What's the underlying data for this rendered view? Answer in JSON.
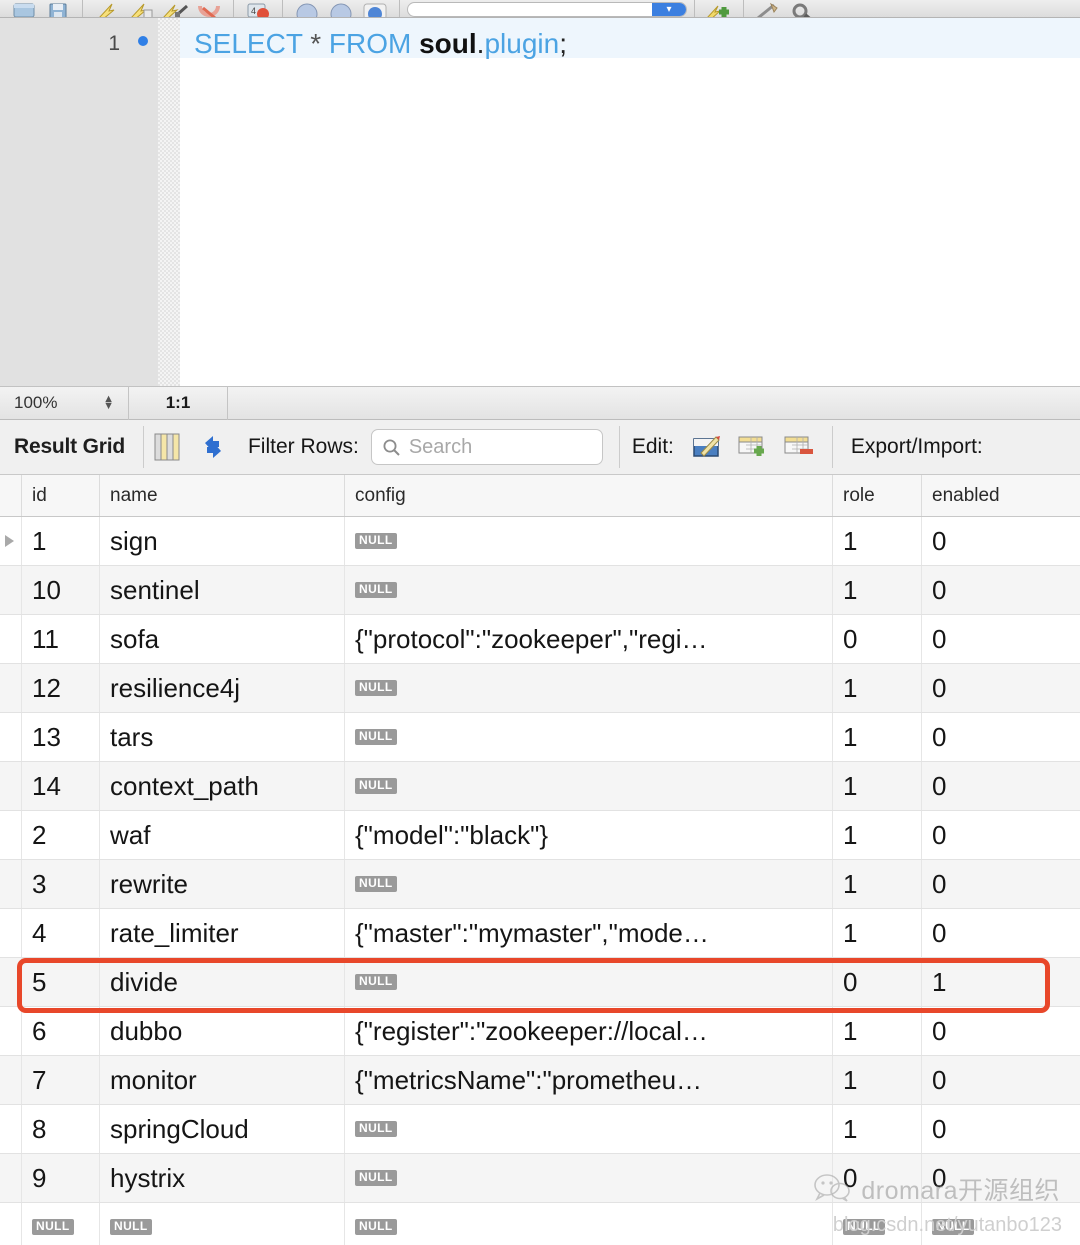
{
  "toolbar": {
    "buttons": [
      {
        "name": "new-tab-icon",
        "label": ""
      },
      {
        "name": "save-icon",
        "label": ""
      },
      {
        "name": "execute-icon",
        "label": ""
      },
      {
        "name": "execute-current-icon",
        "label": ""
      },
      {
        "name": "explain-icon",
        "label": ""
      },
      {
        "name": "stop-icon",
        "label": ""
      },
      {
        "name": "toggle-stop-on-error-icon",
        "label": ""
      },
      {
        "name": "commit-icon",
        "label": ""
      },
      {
        "name": "rollback-icon",
        "label": ""
      },
      {
        "name": "autocommit-icon",
        "label": ""
      },
      {
        "name": "add-snippet-icon",
        "label": ""
      },
      {
        "name": "beautify-icon",
        "label": ""
      },
      {
        "name": "find-icon",
        "label": ""
      }
    ],
    "search_placeholder": "",
    "search_value": "",
    "search_go_label": "▾"
  },
  "editor": {
    "line_number": "1",
    "sql": {
      "select_kw": "SELECT",
      "star": "*",
      "from_kw": "FROM",
      "schema": "soul",
      "dot": ".",
      "table": "plugin",
      "semicolon": ";"
    }
  },
  "statusbar": {
    "zoom": "100%",
    "cursor_position": "1:1"
  },
  "result_toolbar": {
    "title": "Result Grid",
    "grid_view_icon": "grid-view-icon",
    "refresh_icon": "refresh-icon",
    "filter_label": "Filter Rows:",
    "search_placeholder": "Search",
    "search_value": "",
    "edit_label": "Edit:",
    "edit_icons": [
      "edit-row-icon",
      "insert-row-icon",
      "delete-row-icon"
    ],
    "export_label": "Export/Import:"
  },
  "grid": {
    "columns": [
      "id",
      "name",
      "config",
      "role",
      "enabled"
    ],
    "rows": [
      {
        "marker": true,
        "id": "1",
        "name": "sign",
        "config": "NULL",
        "config_null": true,
        "role": "1",
        "enabled": "0"
      },
      {
        "marker": false,
        "id": "10",
        "name": "sentinel",
        "config": "NULL",
        "config_null": true,
        "role": "1",
        "enabled": "0"
      },
      {
        "marker": false,
        "id": "11",
        "name": "sofa",
        "config": "{\"protocol\":\"zookeeper\",\"regi…",
        "config_null": false,
        "role": "0",
        "enabled": "0"
      },
      {
        "marker": false,
        "id": "12",
        "name": "resilience4j",
        "config": "NULL",
        "config_null": true,
        "role": "1",
        "enabled": "0"
      },
      {
        "marker": false,
        "id": "13",
        "name": "tars",
        "config": "NULL",
        "config_null": true,
        "role": "1",
        "enabled": "0"
      },
      {
        "marker": false,
        "id": "14",
        "name": "context_path",
        "config": "NULL",
        "config_null": true,
        "role": "1",
        "enabled": "0"
      },
      {
        "marker": false,
        "id": "2",
        "name": "waf",
        "config": "{\"model\":\"black\"}",
        "config_null": false,
        "role": "1",
        "enabled": "0"
      },
      {
        "marker": false,
        "id": "3",
        "name": "rewrite",
        "config": "NULL",
        "config_null": true,
        "role": "1",
        "enabled": "0"
      },
      {
        "marker": false,
        "id": "4",
        "name": "rate_limiter",
        "config": "{\"master\":\"mymaster\",\"mode…",
        "config_null": false,
        "role": "1",
        "enabled": "0"
      },
      {
        "marker": false,
        "id": "5",
        "name": "divide",
        "config": "NULL",
        "config_null": true,
        "role": "0",
        "enabled": "1",
        "highlighted": true
      },
      {
        "marker": false,
        "id": "6",
        "name": "dubbo",
        "config": "{\"register\":\"zookeeper://local…",
        "config_null": false,
        "role": "1",
        "enabled": "0"
      },
      {
        "marker": false,
        "id": "7",
        "name": "monitor",
        "config": "{\"metricsName\":\"prometheu…",
        "config_null": false,
        "role": "1",
        "enabled": "0"
      },
      {
        "marker": false,
        "id": "8",
        "name": "springCloud",
        "config": "NULL",
        "config_null": true,
        "role": "1",
        "enabled": "0"
      },
      {
        "marker": false,
        "id": "9",
        "name": "hystrix",
        "config": "NULL",
        "config_null": true,
        "role": "0",
        "enabled": "0"
      },
      {
        "marker": false,
        "id": "NULL",
        "id_null": true,
        "name": "NULL",
        "name_null": true,
        "config": "NULL",
        "config_null": true,
        "role": "NULL",
        "role_null": true,
        "enabled": "NULL",
        "enabled_null": true
      }
    ],
    "null_label": "NULL"
  },
  "watermark": {
    "text": "dromara开源组织",
    "url": "blog.csdn.net/yutanbo123"
  },
  "colors": {
    "highlight_border": "#e8472a",
    "sql_keyword": "#4ba3e3",
    "accent_blue": "#2f7fe6",
    "null_badge": "#9a9a9a"
  }
}
